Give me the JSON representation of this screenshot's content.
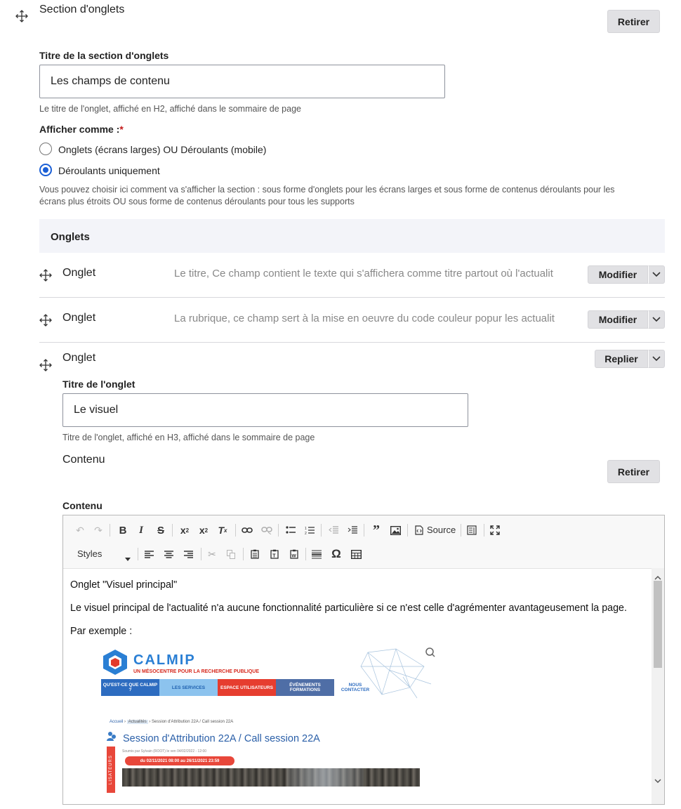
{
  "section": {
    "title": "Section d'onglets",
    "remove_label": "Retirer",
    "tab_section_title_label": "Titre de la section d'onglets",
    "tab_section_title_value": "Les champs de contenu",
    "tab_section_title_desc": "Le titre de l'onglet, affiché en H2, affiché dans le sommaire de page",
    "display_label": "Afficher comme :",
    "required_mark": "*",
    "options": [
      {
        "label": "Onglets (écrans larges) OU Déroulants (mobile)",
        "selected": false
      },
      {
        "label": "Déroulants uniquement",
        "selected": true
      }
    ],
    "display_desc_line1": "Vous pouvez choisir ici comment va s'afficher la section : sous forme d'onglets pour les écrans larges et sous forme de contenus déroulants pour les",
    "display_desc_line2": "écrans plus étroits OU sous forme de contenus déroulants pour tous les supports"
  },
  "tabs": {
    "header": "Onglets",
    "rows": [
      {
        "label": "Onglet",
        "summary": "Le titre, Ce champ contient le texte qui s'affichera comme titre partout où l'actualit",
        "action": "Modifier"
      },
      {
        "label": "Onglet",
        "summary": "La rubrique, ce champ sert à la mise en oeuvre du code couleur popur les actualit",
        "action": "Modifier"
      }
    ],
    "open": {
      "label": "Onglet",
      "action": "Replier",
      "title_label": "Titre de l'onglet",
      "title_value": "Le visuel",
      "title_desc": "Titre de l'onglet, affiché en H3, affiché dans le sommaire de page",
      "content_heading": "Contenu",
      "remove_label": "Retirer",
      "content_label": "Contenu"
    }
  },
  "editor": {
    "source_label": "Source",
    "styles_label": "Styles",
    "paragraphs": [
      "Onglet \"Visuel principal\"",
      "Le visuel principal de l'actualité n'a aucune fonctionnalité particulière si ce n'est celle d'agrémenter avantageusement la page.",
      "Par exemple :"
    ],
    "image": {
      "brand": "CALMIP",
      "tagline": "UN MÉSOCENTRE POUR LA RECHERCHE PUBLIQUE",
      "nav": [
        "QU'EST-CE QUE CALMIP ?",
        "LES SERVICES",
        "ESPACE UTILISATEURS",
        "ÉVÉNEMENTS FORMATIONS",
        "NOUS CONTACTER"
      ],
      "breadcrumb_home": "Accueil",
      "breadcrumb_news": "Actualités",
      "breadcrumb_current": "Session d'Attribution 22A / Call session 22A",
      "article_title": "Session d'Attribution 22A / Call session 22A",
      "meta": "Soumis par Sylvain (ROOT) le ven 04/02/2022 - 12:00",
      "date_badge": "du 02/11/2021 08:00 au 26/11/2021 23:59",
      "side_label": "LISATEURS"
    }
  },
  "colors": {
    "accent": "#1a5fd6",
    "required": "#c41c1c",
    "tabs_header_bg": "#f3f4f9"
  }
}
